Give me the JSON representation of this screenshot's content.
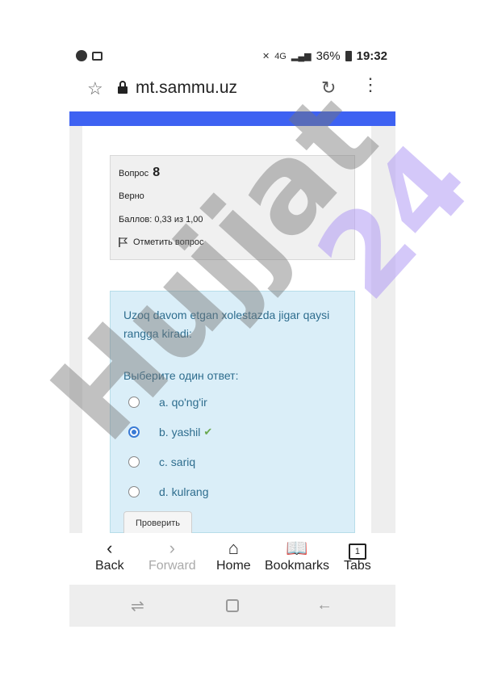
{
  "status_bar": {
    "battery": "36%",
    "time": "19:32",
    "network": "4G"
  },
  "browser": {
    "url": "mt.sammu.uz",
    "icons": [
      "star-icon",
      "lock-icon",
      "reload-icon",
      "menu-icon"
    ]
  },
  "quiz_info": {
    "question_label": "Вопрос",
    "question_number": "8",
    "state": "Верно",
    "grade": "Баллов: 0,33 из 1,00",
    "flag_label": "Отметить вопрос"
  },
  "question": {
    "text": "Uzoq davom etgan xolestazda jigar qaysi rangga kiradi:",
    "prompt": "Выберите один ответ:",
    "answers": [
      {
        "label": "a. qo'ng'ir",
        "selected": false
      },
      {
        "label": "b. yashil",
        "selected": true,
        "correct_mark": "✔"
      },
      {
        "label": "c. sariq",
        "selected": false
      },
      {
        "label": "d. kulrang",
        "selected": false
      }
    ],
    "check_button": "Проверить"
  },
  "bottom_nav": {
    "back": "Back",
    "forward": "Forward",
    "home": "Home",
    "bookmarks": "Bookmarks",
    "tabs": "Tabs",
    "tabs_count": "1"
  },
  "watermark": {
    "left": "Hujjat",
    "right": "24"
  },
  "colors": {
    "accent_bar": "#3e62f2",
    "question_bg": "#daeef8",
    "question_text": "#2e6d8e",
    "watermark_gray": "#777777",
    "watermark_purple": "#b29cf5"
  }
}
